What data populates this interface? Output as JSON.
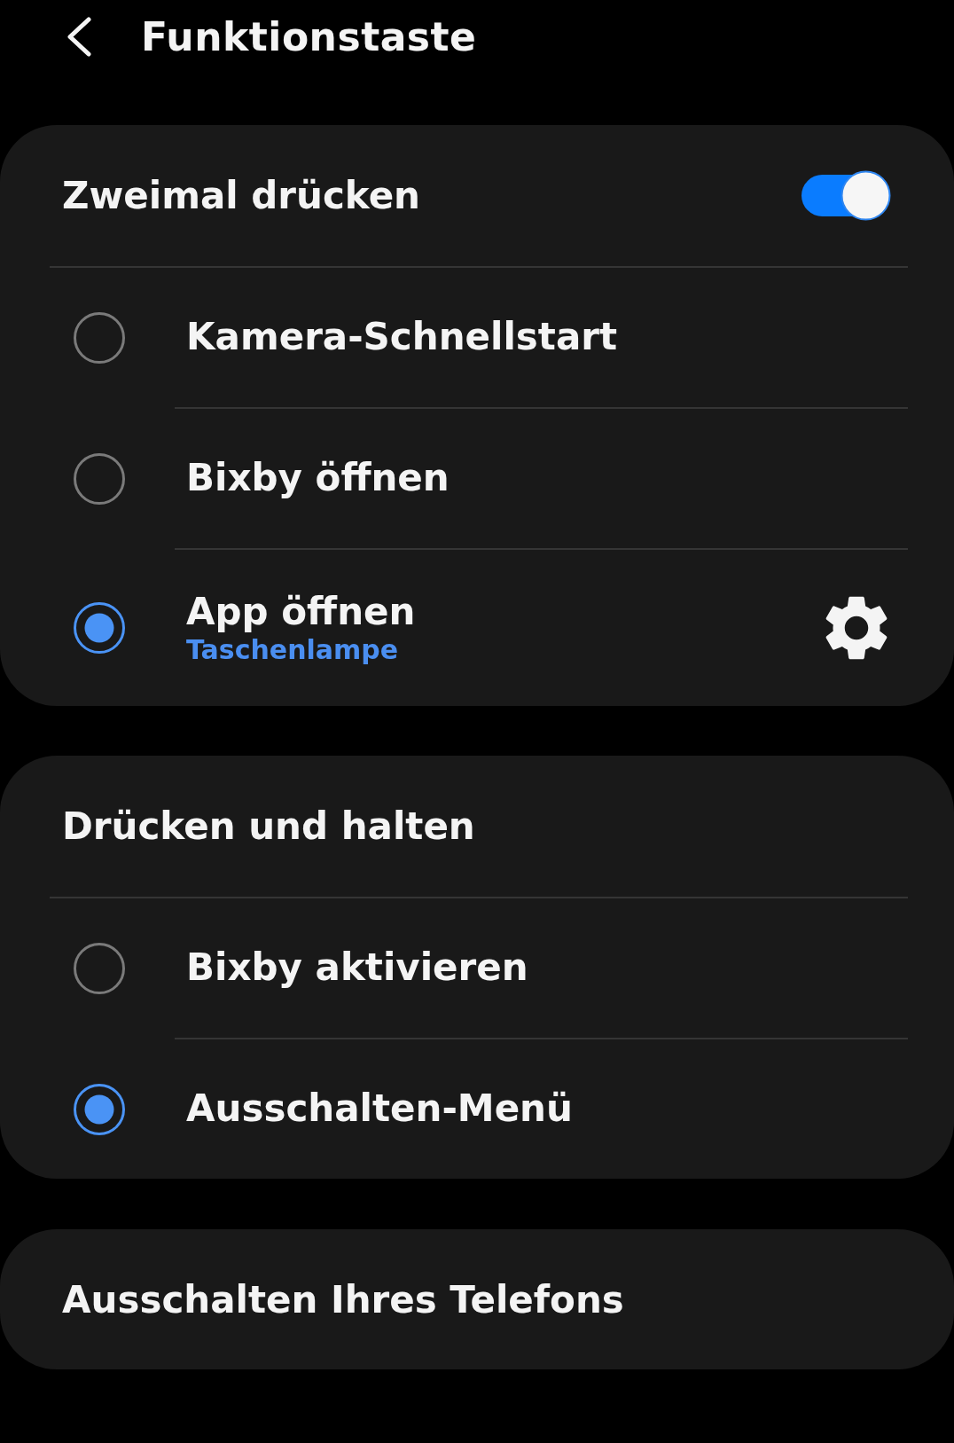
{
  "header": {
    "title": "Funktionstaste"
  },
  "sections": [
    {
      "kind": "group",
      "title": "Zweimal drücken",
      "toggle": {
        "on": true
      },
      "options": [
        {
          "kind": "plain",
          "label": "Kamera-Schnellstart",
          "selected": false
        },
        {
          "kind": "plain",
          "label": "Bixby öffnen",
          "selected": false
        },
        {
          "kind": "app",
          "label": "App öffnen",
          "subtitle": "Taschenlampe",
          "selected": true
        }
      ]
    },
    {
      "kind": "group",
      "title": "Drücken und halten",
      "options": [
        {
          "kind": "plain",
          "label": "Bixby aktivieren",
          "selected": false
        },
        {
          "kind": "plain",
          "label": "Ausschalten-Menü",
          "selected": true
        }
      ]
    },
    {
      "kind": "link",
      "title": "Ausschalten Ihres Telefons"
    }
  ]
}
